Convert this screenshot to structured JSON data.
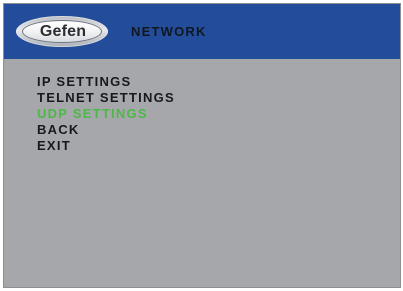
{
  "header": {
    "logo_text": "Gefen",
    "title": "NETWORK"
  },
  "menu": {
    "selected_index": 2,
    "items": [
      {
        "label": "IP SETTINGS"
      },
      {
        "label": "TELNET SETTINGS"
      },
      {
        "label": "UDP SETTINGS"
      },
      {
        "label": "BACK"
      },
      {
        "label": "EXIT"
      }
    ]
  },
  "colors": {
    "header_background": "#234c9a",
    "screen_background": "#a6a7ab",
    "selected_text": "#4db848",
    "menu_text": "#17191d"
  }
}
